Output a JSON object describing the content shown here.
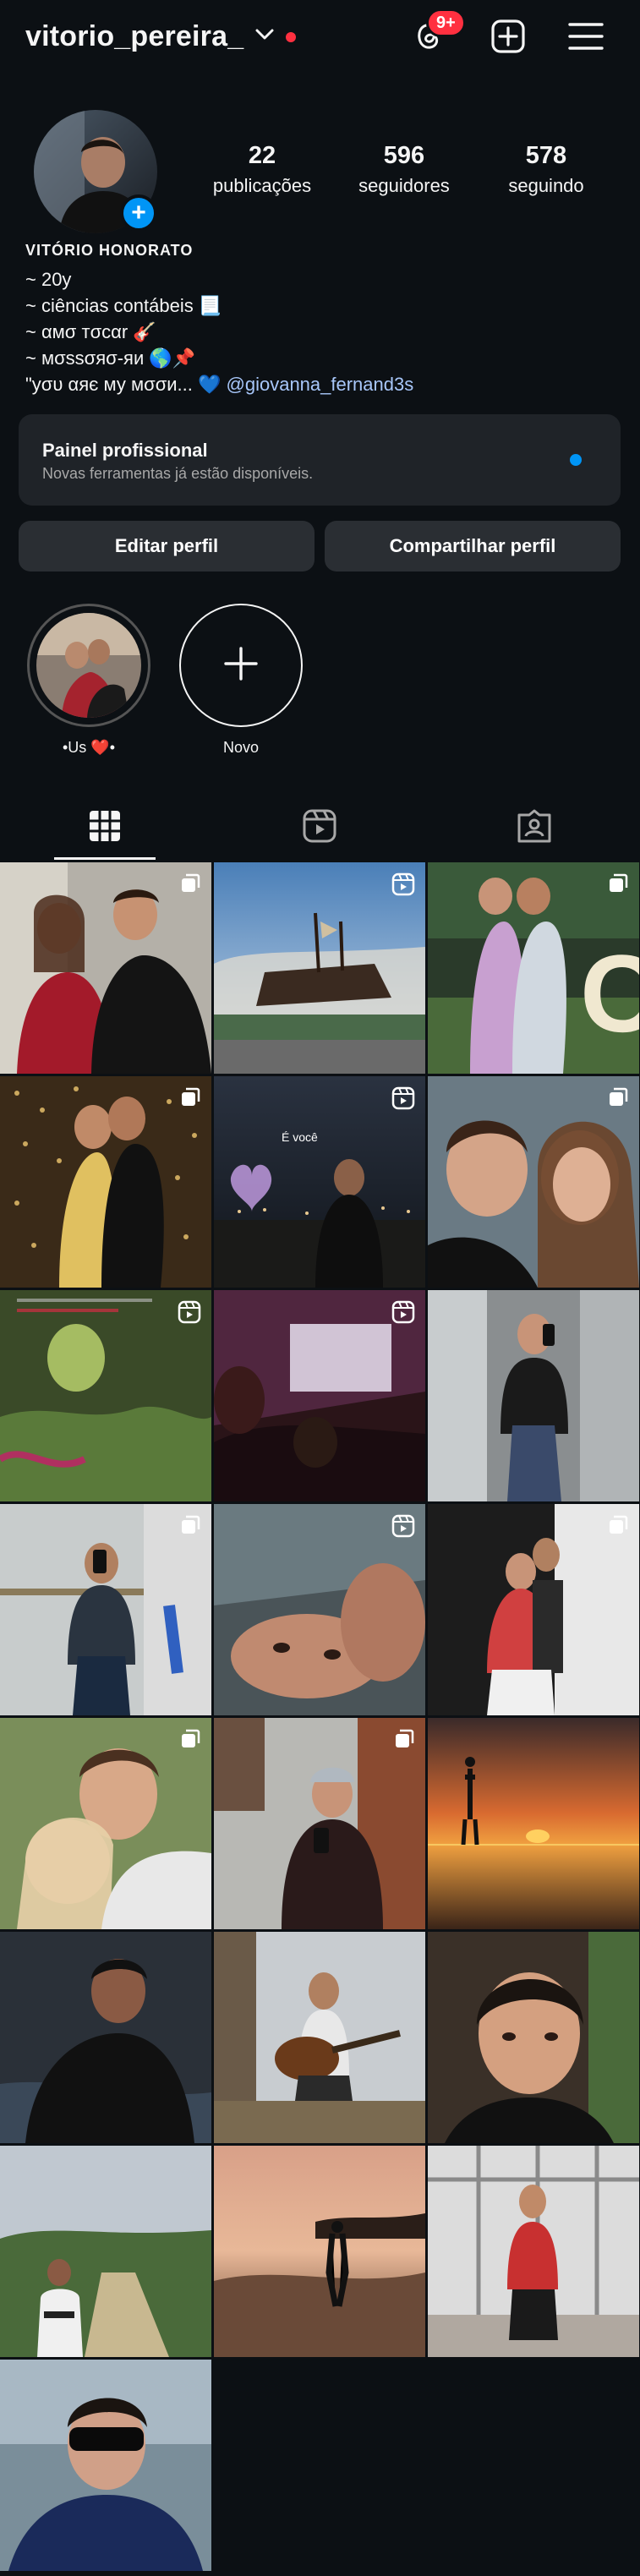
{
  "header": {
    "username": "vitorio_pereira_",
    "notifications_badge": "9+",
    "icons": [
      "chevron-down-icon",
      "threads-icon",
      "create-plus-icon",
      "menu-icon"
    ]
  },
  "stats": [
    {
      "value": "22",
      "label": "publicações"
    },
    {
      "value": "596",
      "label": "seguidores"
    },
    {
      "value": "578",
      "label": "seguindo"
    }
  ],
  "bio": {
    "name": "VITÓRIO HONORATO",
    "lines": [
      "~ 20y",
      "~ ciências contábeis 📃",
      "~ αмσ тσcαr 🎸",
      "~ мσssσяσ-яи 🌎📌"
    ],
    "last_line_text": "\"уσυ αяє му мσσи... 💙 ",
    "mention": "@giovanna_fernand3s"
  },
  "professional_panel": {
    "title": "Painel profissional",
    "subtitle": "Novas ferramentas já estão disponíveis."
  },
  "buttons": {
    "edit": "Editar perfil",
    "share": "Compartilhar perfil"
  },
  "highlights": [
    {
      "label": "•Us ❤️•"
    },
    {
      "label": "Novo"
    }
  ],
  "tabs": [
    "grid-icon",
    "reels-icon",
    "tagged-icon"
  ],
  "colors": {
    "background": "#0c1014",
    "accent_blue": "#0095f6",
    "badge_red": "#ff3040"
  },
  "posts": [
    {
      "type": "carousel"
    },
    {
      "type": "reel"
    },
    {
      "type": "carousel"
    },
    {
      "type": "carousel"
    },
    {
      "type": "reel",
      "overlay_text": "É você"
    },
    {
      "type": "carousel"
    },
    {
      "type": "reel"
    },
    {
      "type": "reel"
    },
    {
      "type": "photo"
    },
    {
      "type": "carousel"
    },
    {
      "type": "reel"
    },
    {
      "type": "carousel"
    },
    {
      "type": "carousel"
    },
    {
      "type": "carousel"
    },
    {
      "type": "photo"
    },
    {
      "type": "photo"
    },
    {
      "type": "photo"
    },
    {
      "type": "photo"
    },
    {
      "type": "photo"
    },
    {
      "type": "photo"
    },
    {
      "type": "photo"
    },
    {
      "type": "photo"
    }
  ]
}
